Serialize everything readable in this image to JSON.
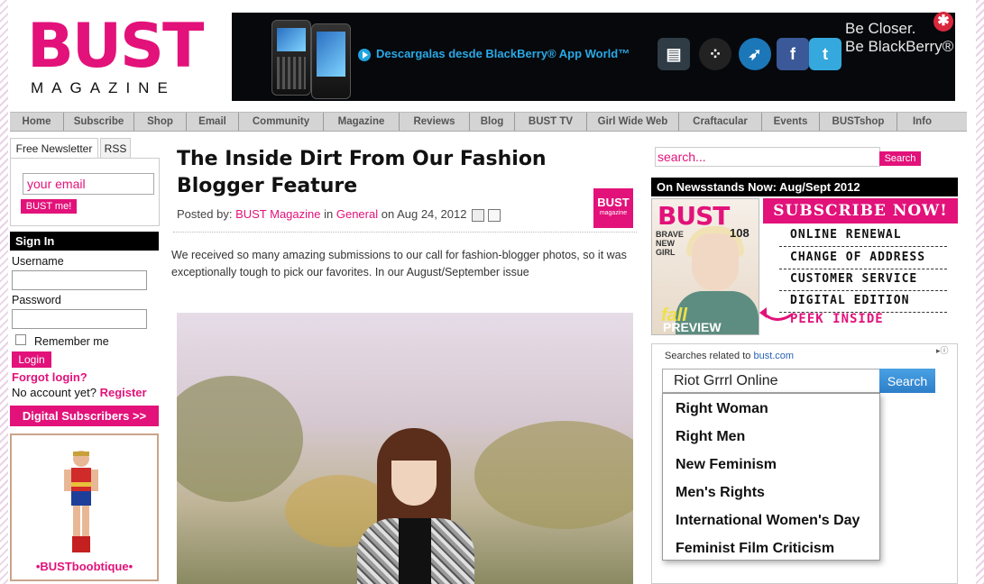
{
  "logo": {
    "word": "BUST",
    "sub": "MAGAZINE"
  },
  "banner": {
    "cta": "Descargalas desde BlackBerry® App World™",
    "tagline1": "Be Closer.",
    "tagline2": "Be BlackBerry®",
    "icons": [
      "bbm-icon",
      "blackberry-icon",
      "twitter-bird-icon",
      "facebook-icon",
      "twitter-icon"
    ]
  },
  "nav": {
    "items": [
      "Home",
      "Subscribe",
      "Shop",
      "Email",
      "Community",
      "Magazine",
      "Reviews",
      "Blog",
      "BUST TV",
      "Girl Wide Web",
      "Craftacular",
      "Events",
      "BUSTshop",
      "Info"
    ]
  },
  "left": {
    "tabs": [
      "Free Newsletter",
      "RSS"
    ],
    "email_value": "your email",
    "newsletter_button": "BUST me!",
    "signin_heading": "Sign In",
    "username_label": "Username",
    "password_label": "Password",
    "remember_label": "Remember me",
    "login_button": "Login",
    "forgot_link": "Forgot login?",
    "no_account": "No account yet?",
    "register_link": "Register",
    "digital_button": "Digital Subscribers >>",
    "ad_label": "•BUSTboobtique•"
  },
  "article": {
    "title": "The Inside Dirt From Our Fashion Blogger Feature",
    "posted_by": "Posted by:",
    "author": "BUST Magazine",
    "in": "in",
    "category": "General",
    "on": "on Aug 24, 2012",
    "mini_logo": "BUST",
    "mini_logo_sub": "magazine",
    "excerpt": "We received so many amazing submissions to our call for fashion-blogger photos, so it was exceptionally tough to pick our favorites. In our August/September issue"
  },
  "right": {
    "search_value": "search...",
    "search_button": "Search",
    "newsstand_heading": "On Newsstands Now: Aug/Sept 2012",
    "cover": {
      "logo": "BUST",
      "brave": "BRAVE NEW GIRL",
      "count": "108",
      "fall": "fall",
      "preview": "PREVIEW"
    },
    "subscribe": "SUBSCRIBE NOW!",
    "links": [
      "ONLINE RENEWAL",
      "CHANGE OF ADDRESS",
      "CUSTOMER SERVICE",
      "DIGITAL EDITION"
    ],
    "peek": "PEEK INSIDE"
  },
  "related": {
    "heading": "Searches related to",
    "domain": "bust.com",
    "query": "Riot Grrrl Online",
    "button": "Search",
    "suggestions": [
      "Right Woman",
      "Right Men",
      "New Feminism",
      "Men's Rights",
      "International Women's Day",
      "Feminist Film Criticism"
    ]
  }
}
